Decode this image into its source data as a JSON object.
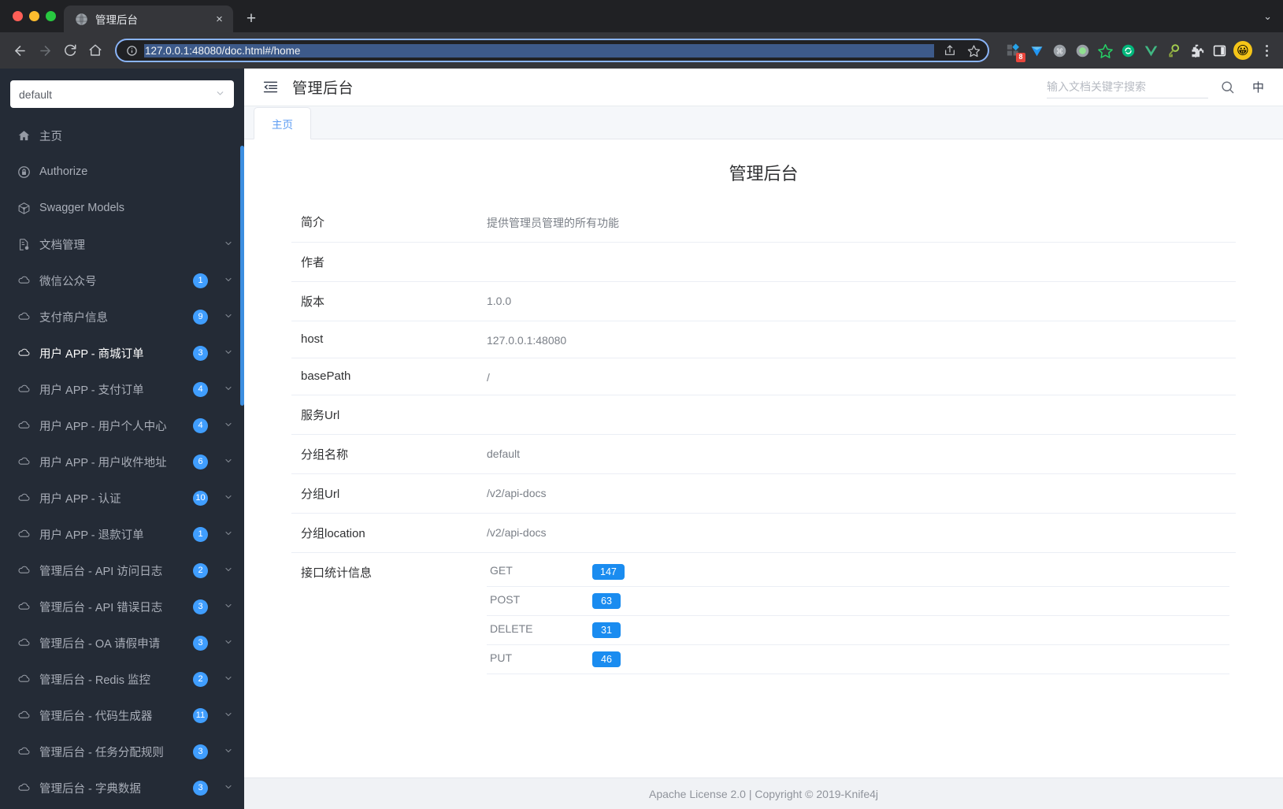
{
  "browser": {
    "tab": {
      "title": "管理后台",
      "favicon": "globe-icon",
      "close_label": "×"
    },
    "new_tab_label": "+",
    "tabstrip_menu_label": "⌄",
    "nav": {
      "back": "←",
      "forward": "→",
      "reload": "⟳",
      "home": "⌂"
    },
    "omnibox": {
      "url": "127.0.0.1:48080/doc.html#/home",
      "info_icon": "info-icon",
      "share_icon": "share-icon",
      "bookmark_icon": "star-icon"
    },
    "extensions": [
      {
        "name": "grid-extension-icon",
        "badge": "8"
      },
      {
        "name": "diamond-extension-icon",
        "badge": ""
      },
      {
        "name": "command-extension-icon",
        "badge": ""
      },
      {
        "name": "circle-extension-icon",
        "badge": ""
      },
      {
        "name": "star-green-extension-icon",
        "badge": ""
      },
      {
        "name": "refresh-green-extension-icon",
        "badge": ""
      },
      {
        "name": "vue-extension-icon",
        "badge": ""
      },
      {
        "name": "key-extension-icon",
        "badge": ""
      },
      {
        "name": "puzzle-extensions-icon",
        "badge": ""
      },
      {
        "name": "sidepanel-icon",
        "badge": ""
      }
    ],
    "avatar": "😀",
    "menu_label": "⋮"
  },
  "sidebar": {
    "group_select": {
      "value": "default",
      "caret": "⌄"
    },
    "items": [
      {
        "label": "主页",
        "icon": "home-icon",
        "badge": "",
        "caret": "",
        "active": false
      },
      {
        "label": "Authorize",
        "icon": "lock-icon",
        "badge": "",
        "caret": "",
        "active": false
      },
      {
        "label": "Swagger Models",
        "icon": "cube-icon",
        "badge": "",
        "caret": "",
        "active": false
      },
      {
        "label": "文档管理",
        "icon": "document-gear-icon",
        "badge": "",
        "caret": "⌄",
        "active": false
      },
      {
        "label": "微信公众号",
        "icon": "cloud-icon",
        "badge": "1",
        "caret": "⌄",
        "active": false
      },
      {
        "label": "支付商户信息",
        "icon": "cloud-icon",
        "badge": "9",
        "caret": "⌄",
        "active": false
      },
      {
        "label": "用户 APP - 商城订单",
        "icon": "cloud-icon",
        "badge": "3",
        "caret": "⌄",
        "active": true
      },
      {
        "label": "用户 APP - 支付订单",
        "icon": "cloud-icon",
        "badge": "4",
        "caret": "⌄",
        "active": false
      },
      {
        "label": "用户 APP - 用户个人中心",
        "icon": "cloud-icon",
        "badge": "4",
        "caret": "⌄",
        "active": false
      },
      {
        "label": "用户 APP - 用户收件地址",
        "icon": "cloud-icon",
        "badge": "6",
        "caret": "⌄",
        "active": false
      },
      {
        "label": "用户 APP - 认证",
        "icon": "cloud-icon",
        "badge": "10",
        "caret": "⌄",
        "active": false
      },
      {
        "label": "用户 APP - 退款订单",
        "icon": "cloud-icon",
        "badge": "1",
        "caret": "⌄",
        "active": false
      },
      {
        "label": "管理后台 - API 访问日志",
        "icon": "cloud-icon",
        "badge": "2",
        "caret": "⌄",
        "active": false
      },
      {
        "label": "管理后台 - API 错误日志",
        "icon": "cloud-icon",
        "badge": "3",
        "caret": "⌄",
        "active": false
      },
      {
        "label": "管理后台 - OA 请假申请",
        "icon": "cloud-icon",
        "badge": "3",
        "caret": "⌄",
        "active": false
      },
      {
        "label": "管理后台 - Redis 监控",
        "icon": "cloud-icon",
        "badge": "2",
        "caret": "⌄",
        "active": false
      },
      {
        "label": "管理后台 - 代码生成器",
        "icon": "cloud-icon",
        "badge": "11",
        "caret": "⌄",
        "active": false
      },
      {
        "label": "管理后台 - 任务分配规则",
        "icon": "cloud-icon",
        "badge": "3",
        "caret": "⌄",
        "active": false
      },
      {
        "label": "管理后台 - 字典数据",
        "icon": "cloud-icon",
        "badge": "3",
        "caret": "⌄",
        "active": false
      }
    ]
  },
  "header": {
    "collapse_icon": "collapse-menu-icon",
    "title": "管理后台",
    "search": {
      "placeholder": "输入文档关键字搜索",
      "value": "",
      "icon": "search-icon"
    },
    "language_toggle": "中"
  },
  "tabs": [
    {
      "label": "主页",
      "active": true
    }
  ],
  "doc": {
    "title": "管理后台",
    "rows": [
      {
        "key": "简介",
        "value": "提供管理员管理的所有功能"
      },
      {
        "key": "作者",
        "value": ""
      },
      {
        "key": "版本",
        "value": "1.0.0"
      },
      {
        "key": "host",
        "value": "127.0.0.1:48080"
      },
      {
        "key": "basePath",
        "value": "/"
      },
      {
        "key": "服务Url",
        "value": ""
      },
      {
        "key": "分组名称",
        "value": "default"
      },
      {
        "key": "分组Url",
        "value": "/v2/api-docs"
      },
      {
        "key": "分组location",
        "value": "/v2/api-docs"
      }
    ],
    "stats_key": "接口统计信息",
    "stats": [
      {
        "method": "GET",
        "count": "147"
      },
      {
        "method": "POST",
        "count": "63"
      },
      {
        "method": "DELETE",
        "count": "31"
      },
      {
        "method": "PUT",
        "count": "46"
      }
    ]
  },
  "footer": {
    "text": "Apache License 2.0 | Copyright © 2019-Knife4j"
  },
  "colors": {
    "accent": "#409eff",
    "badge": "#1a8cf0",
    "sidebar_bg": "#242b36",
    "tab_active": "#5b9bf2"
  }
}
